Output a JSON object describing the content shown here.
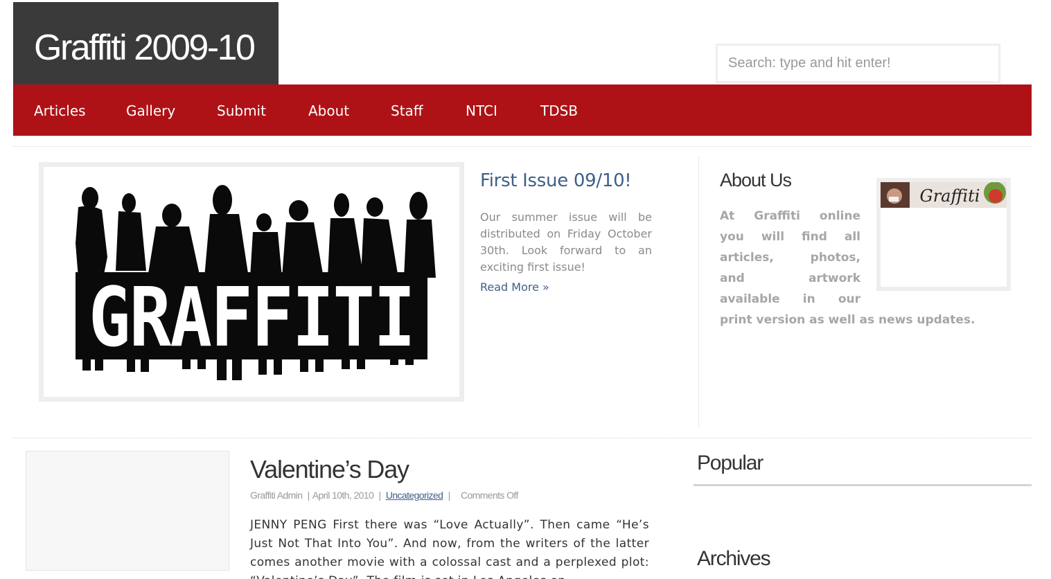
{
  "header": {
    "site_title": "Graffiti 2009-10",
    "search_placeholder": "Search: type and hit enter!"
  },
  "nav": {
    "items": [
      "Articles",
      "Gallery",
      "Submit",
      "About",
      "Staff",
      "NTCI",
      "TDSB"
    ]
  },
  "featured": {
    "image_logo_text": "GRAFFITI",
    "title": "First Issue 09/10!",
    "excerpt": "Our summer issue will be distributed on Friday October 30th. Look forward to an exciting first issue!",
    "read_more": "Read More »"
  },
  "about": {
    "title": "About Us",
    "text_lines": [
      "At Graffiti online",
      "you will find all",
      "articles, photos,",
      "and artwork",
      "available in our",
      "print version as well as news updates."
    ],
    "thumbnail_logo_text": "Graffiti"
  },
  "post": {
    "title": "Valentine’s Day",
    "meta": {
      "author": "Graffiti Admin",
      "date": "April 10th, 2010",
      "category": "Uncategorized",
      "comments": "Comments Off",
      "separator": "|"
    },
    "excerpt": "JENNY PENG First there was “Love Actually”. Then came “He’s Just Not That Into You”. And now, from the writers of the latter comes another movie with a colossal cast and a perplexed plot: “Valentine’s Day”. The film is set in Los Angeles on"
  },
  "sidebar": {
    "popular_title": "Popular",
    "archives_title": "Archives"
  },
  "colors": {
    "nav_background": "#ae1216",
    "title_box_background": "#3a3a3a",
    "link_blue": "#3e5f87"
  }
}
